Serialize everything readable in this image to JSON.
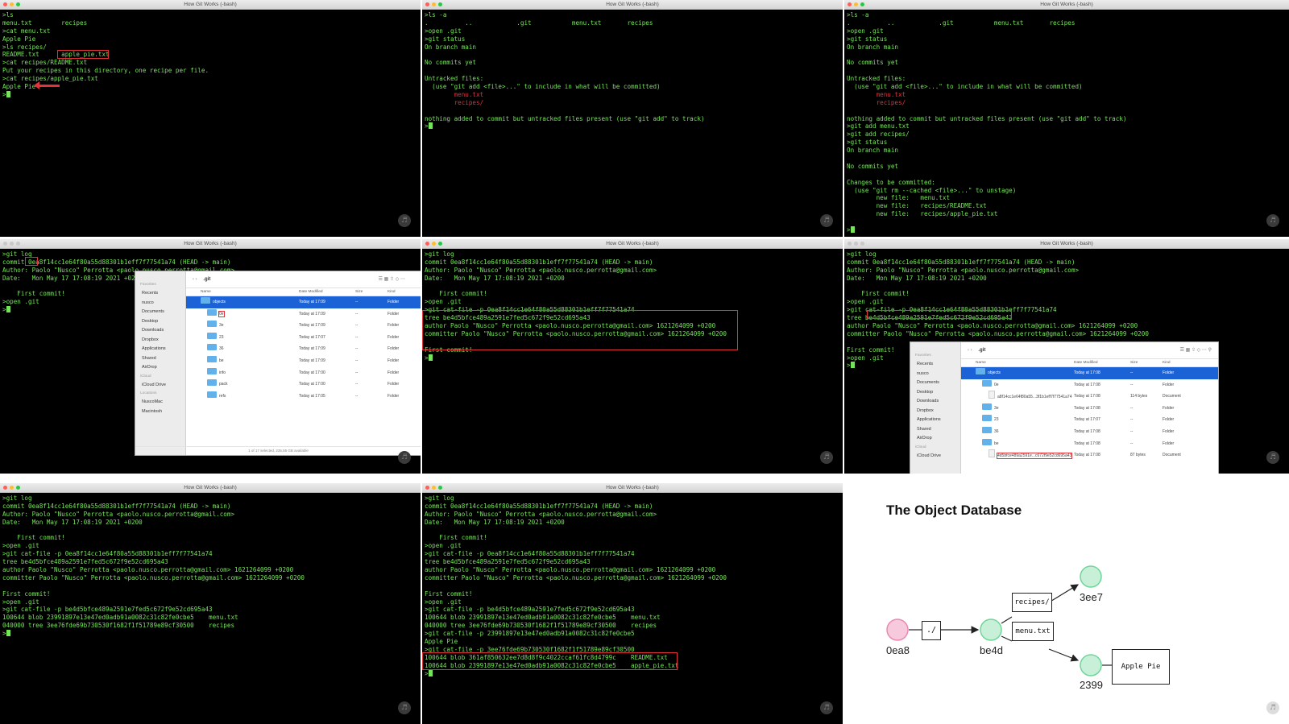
{
  "window_title": "How Git Works (-bash)",
  "panels": {
    "p1": {
      "lines": [
        ">ls",
        "menu.txt        recipes",
        ">cat menu.txt",
        "Apple Pie",
        ">ls recipes/",
        "README.txt      apple_pie.txt",
        ">cat recipes/README.txt",
        "Put your recipes in this directory, one recipe per file.",
        ">cat recipes/apple_pie.txt",
        "Apple Pie",
        ">"
      ]
    },
    "p2": {
      "lines": [
        ">ls -a",
        ".          ..            .git           menu.txt       recipes",
        ">open .git",
        ">git status",
        "On branch main",
        "",
        "No commits yet",
        "",
        "Untracked files:",
        "  (use \"git add <file>...\" to include in what will be committed)",
        "        menu.txt",
        "        recipes/",
        "",
        "nothing added to commit but untracked files present (use \"git add\" to track)",
        ">"
      ]
    },
    "p3": {
      "lines": [
        ">ls -a",
        ".          ..            .git           menu.txt       recipes",
        ">open .git",
        ">git status",
        "On branch main",
        "",
        "No commits yet",
        "",
        "Untracked files:",
        "  (use \"git add <file>...\" to include in what will be committed)",
        "        menu.txt",
        "        recipes/",
        "",
        "nothing added to commit but untracked files present (use \"git add\" to track)",
        ">git add menu.txt",
        ">git add recipes/",
        ">git status",
        "On branch main",
        "",
        "No commits yet",
        "",
        "Changes to be committed:",
        "  (use \"git rm --cached <file>...\" to unstage)",
        "        new file:   menu.txt",
        "        new file:   recipes/README.txt",
        "        new file:   recipes/apple_pie.txt",
        "",
        ">"
      ]
    },
    "p4": {
      "lines": [
        ">git log",
        "commit 0ea8f14cc1e64f80a55d88301b1eff7f77541a74 (HEAD -> main)",
        "Author: Paolo \"Nusco\" Perrotta <paolo.nusco.perrotta@gmail.com>",
        "Date:   Mon May 17 17:08:19 2021 +0200",
        "",
        "    First commit!",
        ">open .git",
        ">"
      ]
    },
    "p5": {
      "lines": [
        ">git log",
        "commit 0ea8f14cc1e64f80a55d88301b1eff7f77541a74 (HEAD -> main)",
        "Author: Paolo \"Nusco\" Perrotta <paolo.nusco.perrotta@gmail.com>",
        "Date:   Mon May 17 17:08:19 2021 +0200",
        "",
        "    First commit!",
        ">open .git",
        ">git cat-file -p 0ea8f14cc1e64f80a55d88301b1eff7f77541a74",
        "tree be4d5bfce489a2591e7fed5c672f9e52cd695a43",
        "author Paolo \"Nusco\" Perrotta <paolo.nusco.perrotta@gmail.com> 1621264099 +0200",
        "committer Paolo \"Nusco\" Perrotta <paolo.nusco.perrotta@gmail.com> 1621264099 +0200",
        "",
        "First commit!",
        ">"
      ]
    },
    "p6": {
      "lines": [
        ">git log",
        "commit 0ea8f14cc1e64f80a55d88301b1eff7f77541a74 (HEAD -> main)",
        "Author: Paolo \"Nusco\" Perrotta <paolo.nusco.perrotta@gmail.com>",
        "Date:   Mon May 17 17:08:19 2021 +0200",
        "",
        "    First commit!",
        ">open .git",
        ">git cat-file -p 0ea8f14cc1e64f80a55d88301b1eff7f77541a74",
        "tree be4d5bfce489a2591e7fed5c672f9e52cd695a43",
        "author Paolo \"Nusco\" Perrotta <paolo.nusco.perrotta@gmail.com> 1621264099 +0200",
        "committer Paolo \"Nusco\" Perrotta <paolo.nusco.perrotta@gmail.com> 1621264099 +0200",
        "",
        "First commit!",
        ">open .git",
        ">"
      ]
    },
    "p7": {
      "lines": [
        ">git log",
        "commit 0ea8f14cc1e64f80a55d88301b1eff7f77541a74 (HEAD -> main)",
        "Author: Paolo \"Nusco\" Perrotta <paolo.nusco.perrotta@gmail.com>",
        "Date:   Mon May 17 17:08:19 2021 +0200",
        "",
        "    First commit!",
        ">open .git",
        ">git cat-file -p 0ea8f14cc1e64f80a55d88301b1eff7f77541a74",
        "tree be4d5bfce489a2591e7fed5c672f9e52cd695a43",
        "author Paolo \"Nusco\" Perrotta <paolo.nusco.perrotta@gmail.com> 1621264099 +0200",
        "committer Paolo \"Nusco\" Perrotta <paolo.nusco.perrotta@gmail.com> 1621264099 +0200",
        "",
        "First commit!",
        ">open .git",
        ">git cat-file -p be4d5bfce489a2591e7fed5c672f9e52cd695a43",
        "100644 blob 23991897e13e47ed0adb91a0082c31c82fe0cbe5    menu.txt",
        "040000 tree 3ee76fde69b730530f1682f1f51789e89cf30500    recipes",
        ">"
      ]
    },
    "p8": {
      "lines": [
        ">git log",
        "commit 0ea8f14cc1e64f80a55d88301b1eff7f77541a74 (HEAD -> main)",
        "Author: Paolo \"Nusco\" Perrotta <paolo.nusco.perrotta@gmail.com>",
        "Date:   Mon May 17 17:08:19 2021 +0200",
        "",
        "    First commit!",
        ">open .git",
        ">git cat-file -p 0ea8f14cc1e64f80a55d88301b1eff7f77541a74",
        "tree be4d5bfce489a2591e7fed5c672f9e52cd695a43",
        "author Paolo \"Nusco\" Perrotta <paolo.nusco.perrotta@gmail.com> 1621264099 +0200",
        "committer Paolo \"Nusco\" Perrotta <paolo.nusco.perrotta@gmail.com> 1621264099 +0200",
        "",
        "First commit!",
        ">open .git",
        ">git cat-file -p be4d5bfce489a2591e7fed5c672f9e52cd695a43",
        "100644 blob 23991897e13e47ed0adb91a0082c31c82fe0cbe5    menu.txt",
        "040000 tree 3ee76fde69b730530f1682f1f51789e89cf30500    recipes",
        ">git cat-file -p 23991897e13e47ed0adb91a0082c31c82fe0cbe5",
        "Apple Pie",
        ">git cat-file -p 3ee76fde69b730530f1682f1f51789e89cf30500",
        "100644 blob 361af850632ee7d8d8f9c4022ccaf61fc8d4799c    README.txt",
        "100644 blob 23991897e13e47ed0adb91a0082c31c82fe0cbe5    apple_pie.txt",
        ">"
      ]
    }
  },
  "finder1": {
    "title": ".git",
    "favorites_header": "Favorites",
    "sidebar": [
      "Recents",
      "nusco",
      "Documents",
      "Desktop",
      "Downloads",
      "Dropbox",
      "Applications",
      "Shared",
      "AirDrop"
    ],
    "icloud_header": "iCloud",
    "icloud": [
      "iCloud Drive"
    ],
    "locations_header": "Locations",
    "locations": [
      "NuscoMac",
      "Macintosh"
    ],
    "columns": [
      "Name",
      "Date Modified",
      "Size",
      "Kind"
    ],
    "rows": [
      {
        "name": "objects",
        "date": "Today at 17:09",
        "size": "--",
        "kind": "Folder"
      },
      {
        "name": "0e",
        "date": "Today at 17:09",
        "size": "--",
        "kind": "Folder"
      },
      {
        "name": "3e",
        "date": "Today at 17:09",
        "size": "--",
        "kind": "Folder"
      },
      {
        "name": "23",
        "date": "Today at 17:07",
        "size": "--",
        "kind": "Folder"
      },
      {
        "name": "36",
        "date": "Today at 17:09",
        "size": "--",
        "kind": "Folder"
      },
      {
        "name": "be",
        "date": "Today at 17:09",
        "size": "--",
        "kind": "Folder"
      },
      {
        "name": "info",
        "date": "Today at 17:00",
        "size": "--",
        "kind": "Folder"
      },
      {
        "name": "pack",
        "date": "Today at 17:00",
        "size": "--",
        "kind": "Folder"
      },
      {
        "name": "refs",
        "date": "Today at 17:05",
        "size": "--",
        "kind": "Folder"
      }
    ],
    "status": "1 of 17 selected, 235,55 GB available"
  },
  "finder2": {
    "title": ".git",
    "favorites_header": "Favorites",
    "sidebar": [
      "Recents",
      "nusco",
      "Documents",
      "Desktop",
      "Downloads",
      "Dropbox",
      "Applications",
      "Shared",
      "AirDrop"
    ],
    "icloud_header": "iCloud",
    "icloud": [
      "iCloud Drive"
    ],
    "columns": [
      "Name",
      "Date Modified",
      "Size",
      "Kind"
    ],
    "rows": [
      {
        "name": "objects",
        "date": "Today at 17:08",
        "size": "--",
        "kind": "Folder"
      },
      {
        "name": "0e",
        "date": "Today at 17:08",
        "size": "--",
        "kind": "Folder"
      },
      {
        "name": "a8f14cc1e64f80a55...3f1b1eff7f77541a74",
        "date": "Today at 17:08",
        "size": "114 bytes",
        "kind": "Document"
      },
      {
        "name": "3e",
        "date": "Today at 17:08",
        "size": "--",
        "kind": "Folder"
      },
      {
        "name": "23",
        "date": "Today at 17:07",
        "size": "--",
        "kind": "Folder"
      },
      {
        "name": "36",
        "date": "Today at 17:08",
        "size": "--",
        "kind": "Folder"
      },
      {
        "name": "be",
        "date": "Today at 17:08",
        "size": "--",
        "kind": "Folder"
      },
      {
        "name": "4d5bfce489a2591e...c672f9e52cd695a43",
        "date": "Today at 17:08",
        "size": "87 bytes",
        "kind": "Document"
      }
    ]
  },
  "slide": {
    "title": "The Object Database",
    "nodes": {
      "commit": "0ea8",
      "tree_root": "be4d",
      "tree_recipes": "3ee7",
      "blob": "2399"
    },
    "boxes": {
      "root": "./",
      "recipes": "recipes/",
      "menu": "menu.txt",
      "content": "Apple Pie"
    },
    "colors": {
      "commit": "#f7c9dc",
      "tree": "#c8f0d8",
      "commit_stroke": "#e98ab0",
      "tree_stroke": "#6fd69a"
    }
  },
  "accent_red": "#e0333a",
  "terminal_green": "#76e45a"
}
